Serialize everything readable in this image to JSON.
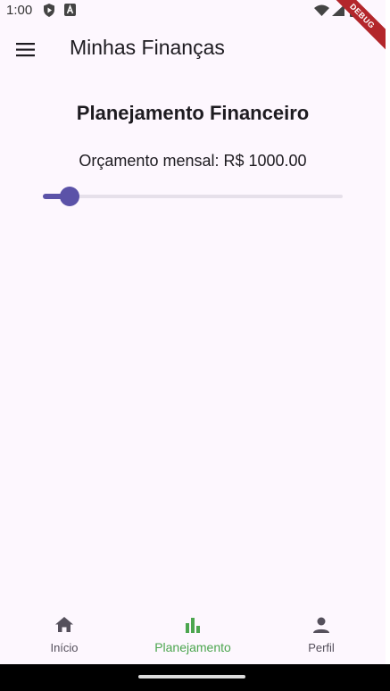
{
  "status": {
    "time": "1:00",
    "icons": [
      "shield-play-icon",
      "text-a-icon",
      "wifi-icon",
      "signal-icon",
      "battery-icon"
    ]
  },
  "debug_banner": "DEBUG",
  "appbar": {
    "title": "Minhas Finanças",
    "menu_icon": "menu-icon"
  },
  "main": {
    "heading": "Planejamento Financeiro",
    "budget_label": "Orçamento mensal: R$ 1000.00",
    "slider": {
      "value_fraction": 0.09,
      "color": "#5b52a8"
    }
  },
  "bottom_nav": {
    "items": [
      {
        "label": "Início",
        "icon": "home-icon",
        "active": false
      },
      {
        "label": "Planejamento",
        "icon": "bar-chart-icon",
        "active": true
      },
      {
        "label": "Perfil",
        "icon": "person-icon",
        "active": false
      }
    ],
    "active_color": "#4ca64f"
  }
}
